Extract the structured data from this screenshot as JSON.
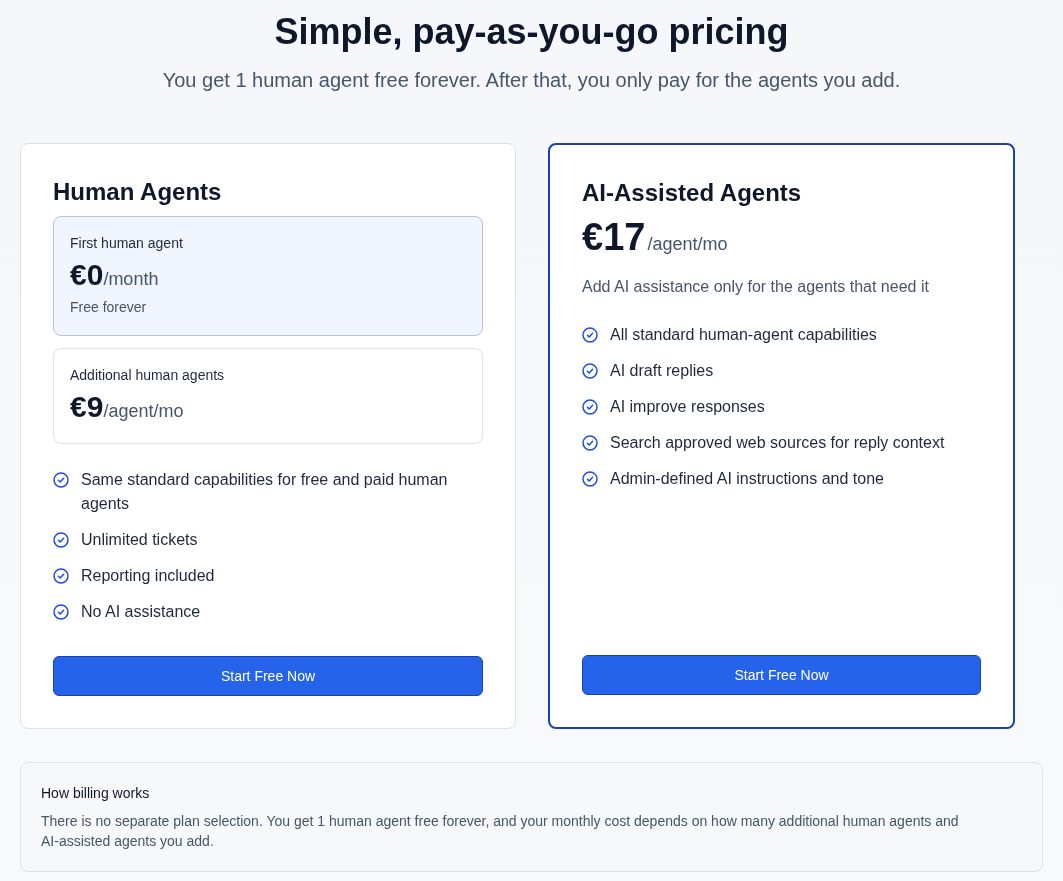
{
  "header": {
    "title": "Simple, pay-as-you-go pricing",
    "subtitle": "You get 1 human agent free forever. After that, you only pay for the agents you add."
  },
  "plans": [
    {
      "kind": "tiered",
      "name": "Human Agents",
      "featured": false,
      "tiers": [
        {
          "label": "First human agent",
          "price": "€0",
          "period": "/month",
          "note": "Free forever",
          "highlighted": true
        },
        {
          "label": "Additional human agents",
          "price": "€9",
          "period": "/agent/mo",
          "highlighted": false
        }
      ],
      "features": [
        "Same standard capabilities for free and paid human agents",
        "Unlimited tickets",
        "Reporting included",
        "No AI assistance"
      ],
      "button": "Start Free Now"
    },
    {
      "kind": "flat",
      "name": "AI-Assisted Agents",
      "featured": true,
      "price": "€17",
      "period": "/agent/mo",
      "description": "Add AI assistance only for the agents that need it",
      "features": [
        "All standard human-agent capabilities",
        "AI draft replies",
        "AI improve responses",
        "Search approved web sources for reply context",
        "Admin-defined AI instructions and tone"
      ],
      "button": "Start Free Now"
    }
  ],
  "billing_note": {
    "title": "How billing works",
    "text": "There is no separate plan selection. You get 1 human agent free forever, and your monthly cost depends on how many additional human agents and AI-assisted agents you add."
  }
}
